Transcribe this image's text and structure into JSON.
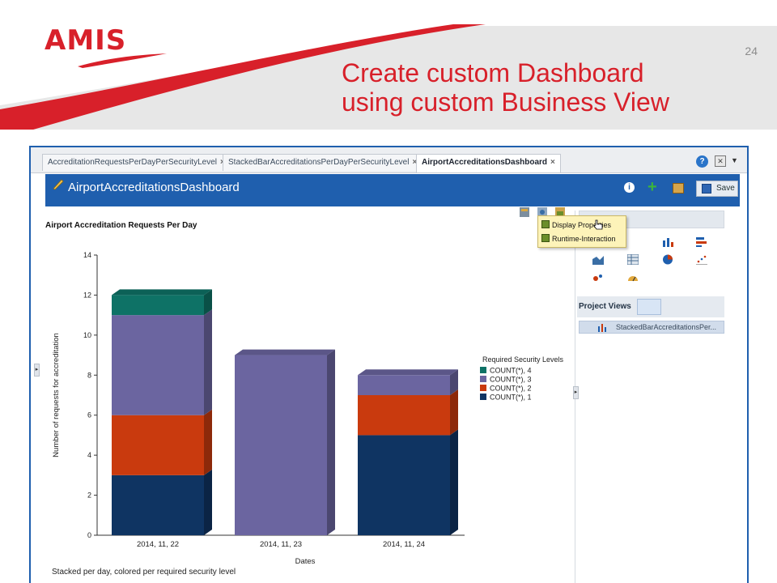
{
  "slide": {
    "logo": "AMIS",
    "page_number": "24",
    "title_line1": "Create custom Dashboard",
    "title_line2": "using custom Business View"
  },
  "tabs": [
    {
      "label": "AccreditationRequestsPerDayPerSecurityLevel",
      "close": "×"
    },
    {
      "label": "StackedBarAccreditationsPerDayPerSecurityLevel",
      "close": "×"
    },
    {
      "label": "AirportAccreditationsDashboard",
      "close": "×"
    }
  ],
  "tabbar_icons": {
    "help": "?",
    "close_all": "✕",
    "menu": "▼"
  },
  "dashboard": {
    "title": "AirportAccreditationsDashboard",
    "save_label": "Save",
    "info": "i",
    "plus": "+"
  },
  "chart_panel": {
    "title": "Airport Accreditation Requests Per Day",
    "caption": "Stacked per day, colored per required security level"
  },
  "context_menu": {
    "items": [
      "Display Properties",
      "Runtime-Interaction"
    ]
  },
  "project_views": {
    "label": "Project Views",
    "items": [
      "StackedBarAccreditationsPer..."
    ]
  },
  "icons": [
    "pencil-icon",
    "info-icon",
    "plus-icon",
    "export-icon",
    "save-disk-icon",
    "properties-icon",
    "interaction-icon",
    "bar-chart-icon",
    "table-icon",
    "pie-chart-icon",
    "scatter-icon",
    "gauge-icon",
    "refresh-icon"
  ],
  "colors": {
    "accent_red": "#d8202a",
    "header_blue": "#1f5fae",
    "series_count1": "#0f3462",
    "series_count2": "#c93a0e",
    "series_count3": "#6b65a0",
    "series_count4": "#0e7266"
  },
  "chart_data": {
    "type": "bar",
    "stacked": true,
    "three_d": true,
    "categories": [
      "2014, 11, 22",
      "2014, 11, 23",
      "2014, 11, 24"
    ],
    "series": [
      {
        "name": "COUNT(*), 1",
        "values": [
          3,
          0,
          5
        ],
        "color": "#0f3462"
      },
      {
        "name": "COUNT(*), 2",
        "values": [
          3,
          0,
          2
        ],
        "color": "#c93a0e"
      },
      {
        "name": "COUNT(*), 3",
        "values": [
          5,
          9,
          1
        ],
        "color": "#6b65a0"
      },
      {
        "name": "COUNT(*), 4",
        "values": [
          1,
          0,
          0
        ],
        "color": "#0e7266"
      }
    ],
    "xlabel": "Dates",
    "ylabel": "Number of requests for accreditation",
    "ylim": [
      0,
      14
    ],
    "yticks": [
      0,
      2,
      4,
      6,
      8,
      10,
      12,
      14
    ],
    "legend_title": "Required Security Levels",
    "legend_position": "right",
    "grid": false
  }
}
